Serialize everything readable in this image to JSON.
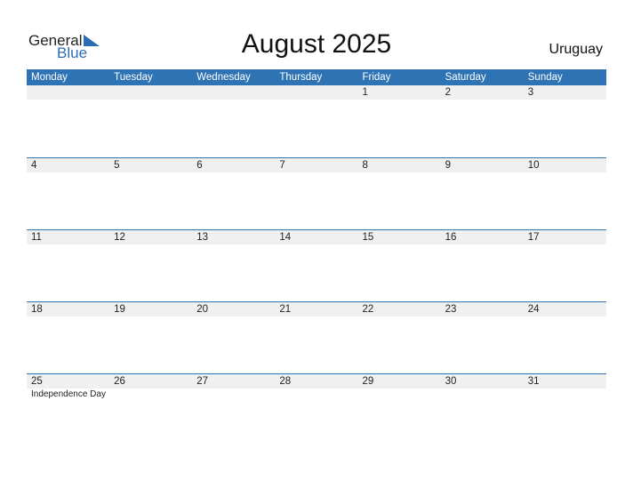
{
  "logo": {
    "general": "General",
    "blue": "Blue",
    "icon": "triangle-flag-icon"
  },
  "title": "August 2025",
  "country": "Uruguay",
  "colors": {
    "header": "#2e73b4",
    "row_bg": "#f0f0f0"
  },
  "weekdays": [
    "Monday",
    "Tuesday",
    "Wednesday",
    "Thursday",
    "Friday",
    "Saturday",
    "Sunday"
  ],
  "weeks": [
    {
      "days": [
        "",
        "",
        "",
        "",
        "1",
        "2",
        "3"
      ],
      "events": [
        "",
        "",
        "",
        "",
        "",
        "",
        ""
      ]
    },
    {
      "days": [
        "4",
        "5",
        "6",
        "7",
        "8",
        "9",
        "10"
      ],
      "events": [
        "",
        "",
        "",
        "",
        "",
        "",
        ""
      ]
    },
    {
      "days": [
        "11",
        "12",
        "13",
        "14",
        "15",
        "16",
        "17"
      ],
      "events": [
        "",
        "",
        "",
        "",
        "",
        "",
        ""
      ]
    },
    {
      "days": [
        "18",
        "19",
        "20",
        "21",
        "22",
        "23",
        "24"
      ],
      "events": [
        "",
        "",
        "",
        "",
        "",
        "",
        ""
      ]
    },
    {
      "days": [
        "25",
        "26",
        "27",
        "28",
        "29",
        "30",
        "31"
      ],
      "events": [
        "Independence Day",
        "",
        "",
        "",
        "",
        "",
        ""
      ]
    }
  ]
}
